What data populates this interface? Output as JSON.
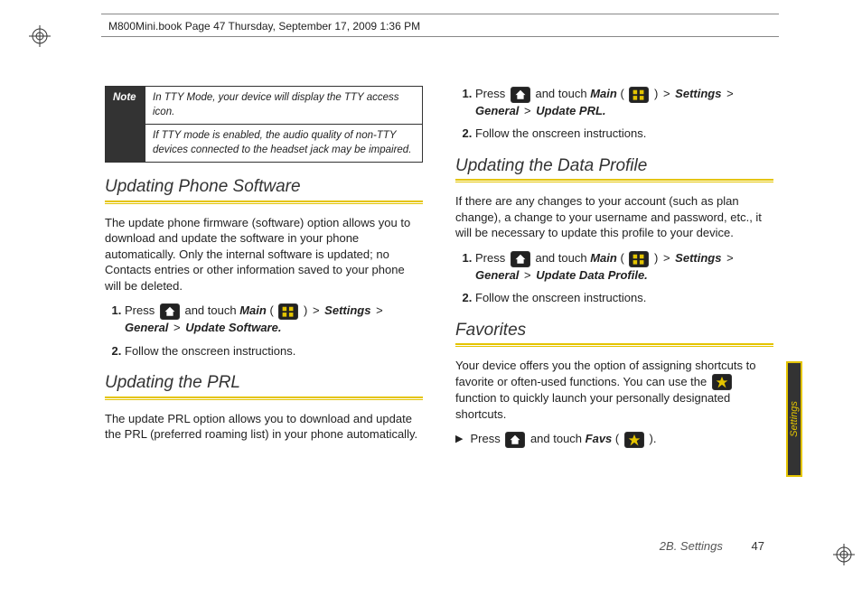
{
  "header": {
    "meta": "M800Mini.book  Page 47  Thursday, September 17, 2009  1:36 PM"
  },
  "note": {
    "label": "Note",
    "row1": "In TTY Mode, your device will display the TTY access icon.",
    "row2": "If TTY mode is enabled, the audio quality of non-TTY devices connected to the headset jack may be impaired."
  },
  "left": {
    "h1": "Updating Phone Software",
    "p1": "The update phone firmware (software) option allows you to download and update the software in your phone automatically. Only the internal software is updated; no Contacts entries or other information saved to your phone will be deleted.",
    "s1a": "Press ",
    "s1b": " and touch ",
    "main": "Main",
    "s1c": " ( ",
    "s1d": " ) ",
    "gt": ">",
    "settings": "Settings",
    "general": "General",
    "updsoft": "Update Software.",
    "s2": "Follow the onscreen instructions.",
    "h2": "Updating the PRL",
    "p2": "The update PRL option allows you to download and update the PRL (preferred roaming list) in your phone automatically."
  },
  "right": {
    "s1a": "Press ",
    "s1b": " and touch ",
    "main": "Main",
    "s1c": " ( ",
    "s1d": " ) ",
    "gt": ">",
    "settings": "Settings",
    "general": "General",
    "updprl": "Update PRL.",
    "s2": "Follow the onscreen instructions.",
    "h1": "Updating the Data Profile",
    "p1": "If there are any changes to your account (such as plan change), a change to your username and password, etc., it will be necessary to update this profile to your device.",
    "upddata": "Update Data Profile.",
    "h2": "Favorites",
    "p2a": "Your device offers you the option of assigning shortcuts to favorite or often-used functions. You can use the ",
    "p2b": " function to quickly launch your personally designated shortcuts.",
    "favs": "Favs",
    "favtail": " ( ",
    "favtail2": " )."
  },
  "sidetab": "Settings",
  "footer": {
    "section": "2B. Settings",
    "page": "47"
  }
}
